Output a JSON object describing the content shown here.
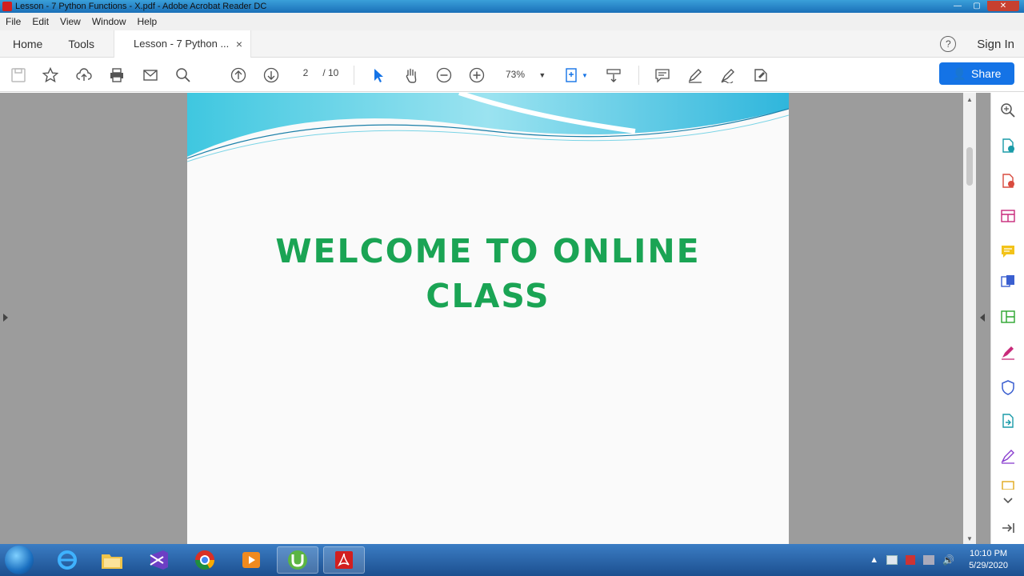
{
  "window": {
    "title": "Lesson - 7 Python Functions - X.pdf - Adobe Acrobat Reader DC"
  },
  "menu": [
    "File",
    "Edit",
    "View",
    "Window",
    "Help"
  ],
  "tabs": {
    "home": "Home",
    "tools": "Tools",
    "document": "Lesson - 7 Python ...",
    "close": "×"
  },
  "header": {
    "help": "?",
    "signin": "Sign In"
  },
  "toolbar": {
    "page_current": "2",
    "page_total": "/ 10",
    "zoom": "73%",
    "share_label": "Share"
  },
  "document": {
    "heading_line1": "WELCOME TO ONLINE",
    "heading_line2": "CLASS"
  },
  "taskbar": {
    "time": "10:10 PM",
    "date": "5/29/2020"
  },
  "colors": {
    "accent": "#1473e6",
    "heading": "#1aa454",
    "taskbar": "#1c4f8f"
  }
}
